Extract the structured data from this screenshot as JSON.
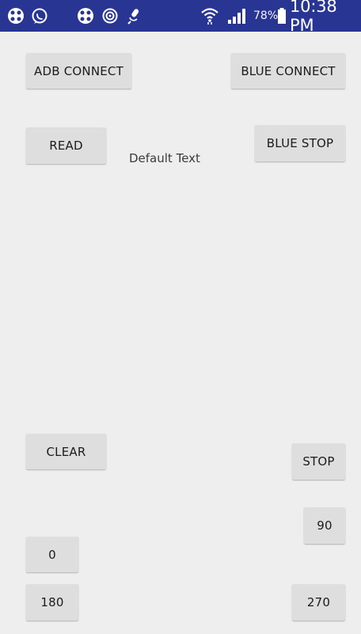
{
  "status_bar": {
    "battery_percent": "78%",
    "time": "10:38 PM"
  },
  "buttons": {
    "adb_connect": "ADB CONNECT",
    "blue_connect": "BLUE CONNECT",
    "read": "READ",
    "blue_stop": "BLUE STOP",
    "clear": "CLEAR",
    "stop": "STOP",
    "ninety": "90",
    "zero": "0",
    "one_eighty": "180",
    "two_seventy": "270"
  },
  "output_text": "Default Text",
  "icons": [
    "app-grid-icon",
    "whatsapp-icon",
    "moon-icon",
    "app-grid-icon",
    "sync-icon",
    "microphone-icon",
    "wifi-icon",
    "signal-icon",
    "battery-icon"
  ],
  "colors": {
    "status_bar": "#283593",
    "background": "#eeeeee",
    "button": "#dedede"
  }
}
